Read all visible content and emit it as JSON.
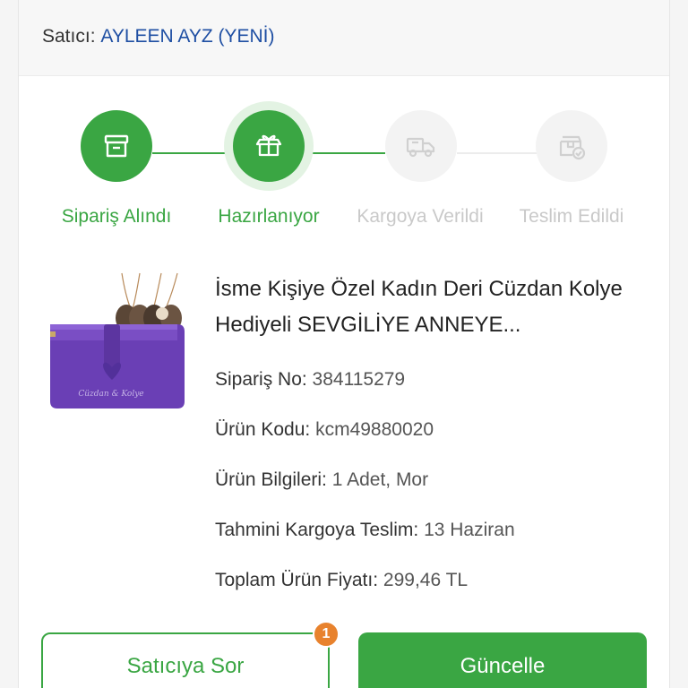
{
  "seller": {
    "label": "Satıcı:",
    "name": "AYLEEN AYZ (YENİ)"
  },
  "steps": [
    {
      "label": "Sipariş Alındı",
      "icon": "box-icon",
      "state": "done"
    },
    {
      "label": "Hazırlanıyor",
      "icon": "open-box-icon",
      "state": "active"
    },
    {
      "label": "Kargoya Verildi",
      "icon": "truck-icon",
      "state": "todo"
    },
    {
      "label": "Teslim Edildi",
      "icon": "delivered-box-icon",
      "state": "todo"
    }
  ],
  "product": {
    "title": "İsme Kişiye Özel Kadın Deri Cüzdan Kolye Hediyeli SEVGİLİYE ANNEYE...",
    "image_caption": "Cüzdan & Kolye",
    "order_no_label": "Sipariş No:",
    "order_no": "384115279",
    "code_label": "Ürün Kodu:",
    "code": "kcm49880020",
    "info_label": "Ürün Bilgileri:",
    "info": "1 Adet, Mor",
    "eta_label": "Tahmini Kargoya Teslim:",
    "eta": "13 Haziran",
    "total_label": "Toplam Ürün Fiyatı:",
    "total": "299,46 TL"
  },
  "actions": {
    "ask_label": "Satıcıya Sor",
    "ask_badge": "1",
    "update_label": "Güncelle"
  },
  "colors": {
    "accent": "#3aa643",
    "seller": "#1f4fa3",
    "badge": "#e8822d",
    "inactive": "#c9c9c9"
  }
}
